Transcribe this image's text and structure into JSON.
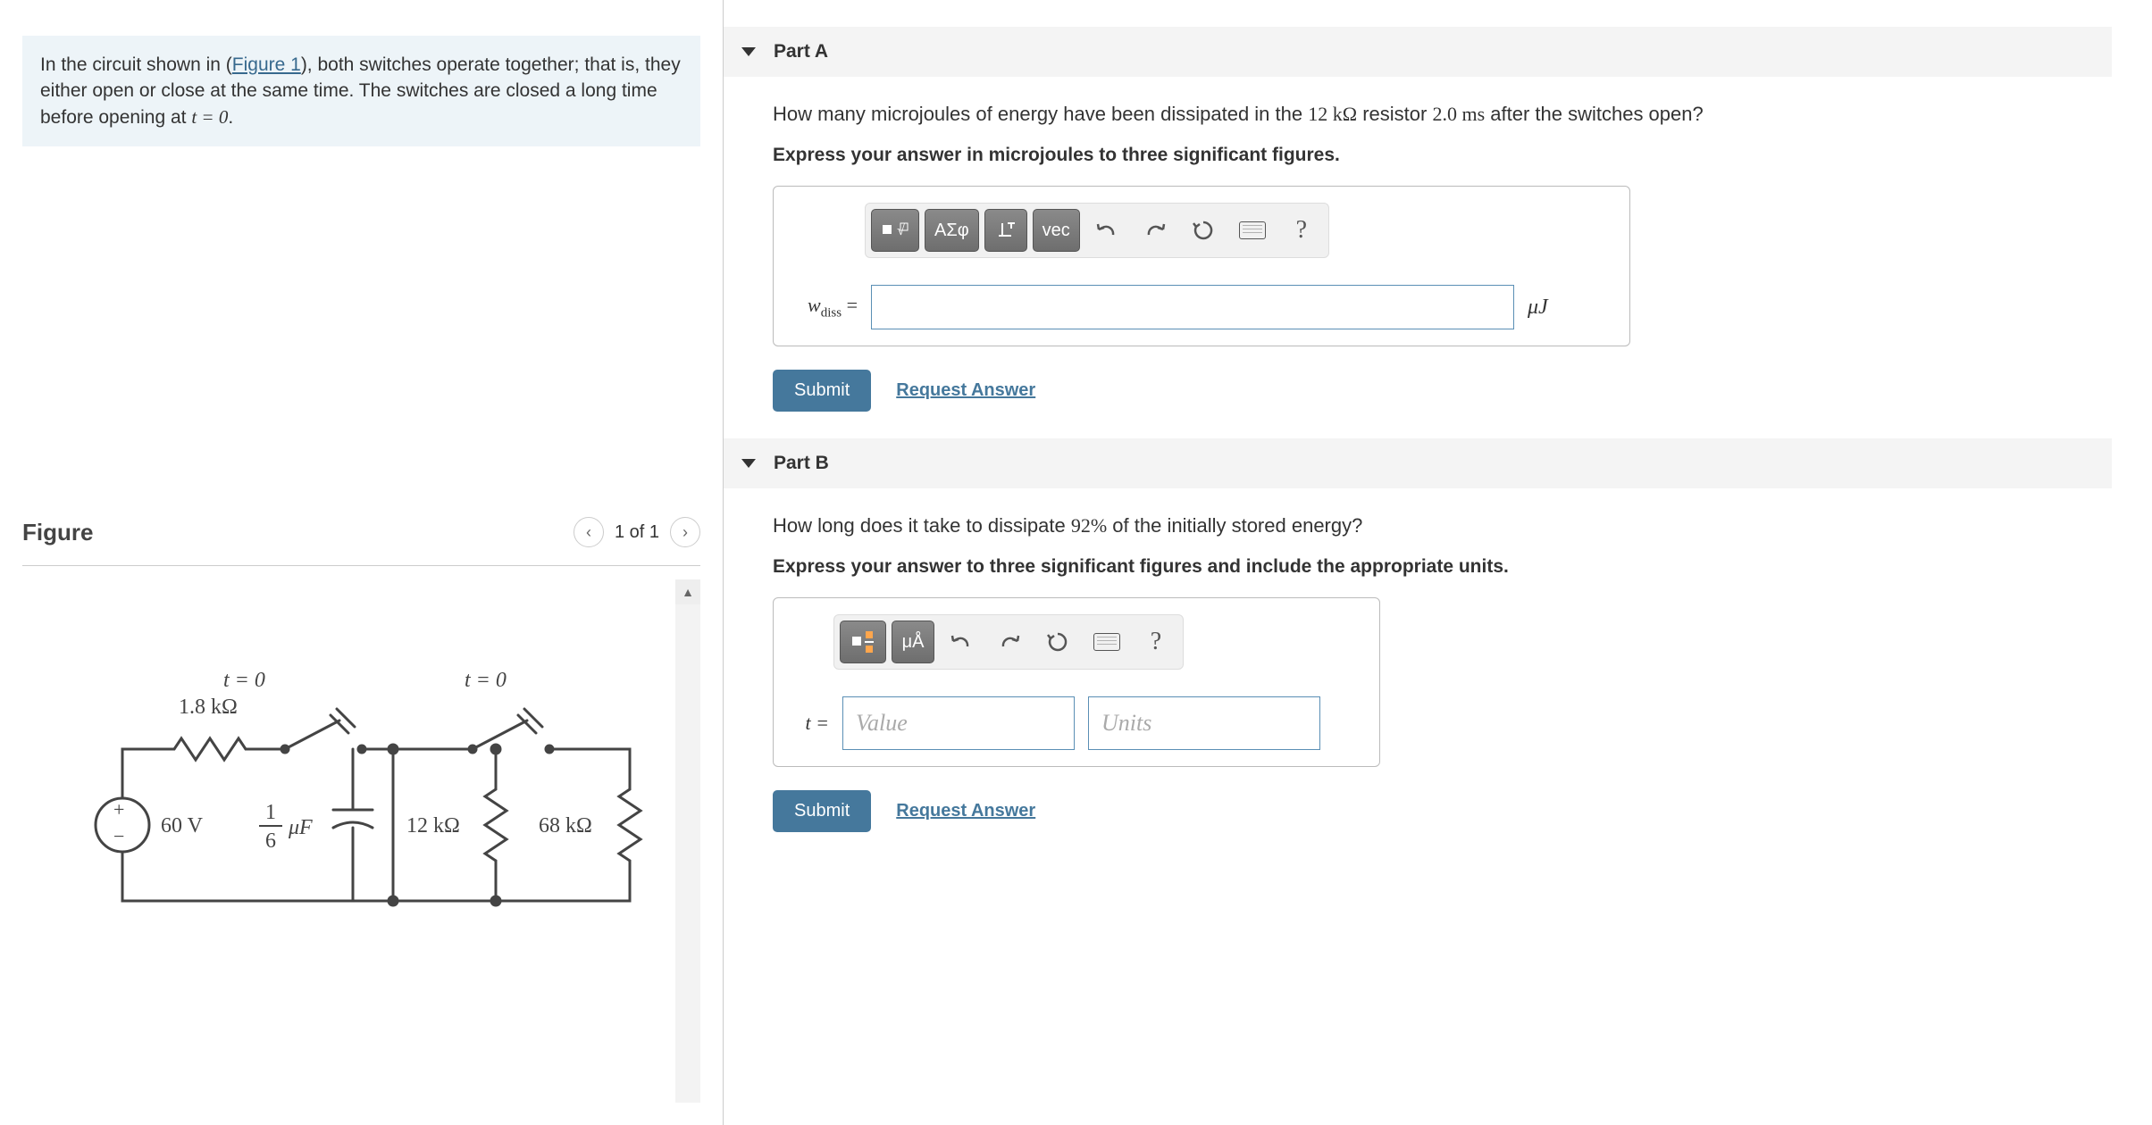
{
  "intro": {
    "prefix": "In the circuit shown in (",
    "figure_link": "Figure 1",
    "suffix": "), both switches operate together; that is, they either open or close at the same time. The switches are closed a long time before opening at ",
    "eqn": "t = 0",
    "end": "."
  },
  "figure": {
    "title": "Figure",
    "count": "1 of 1",
    "circuit": {
      "t0_left": "t = 0",
      "r1": "1.8 kΩ",
      "t0_right": "t = 0",
      "vsrc": "60 V",
      "cap_frac_top": "1",
      "cap_frac_bot": "6",
      "cap_unit": "μF",
      "r2": "12 kΩ",
      "r3": "68 kΩ"
    }
  },
  "partA": {
    "title": "Part A",
    "question_pre": "How many microjoules of energy have been dissipated in the ",
    "q_val1": "12 kΩ",
    "q_mid": " resistor ",
    "q_val2": "2.0 ms",
    "q_post": " after the switches open?",
    "instruction": "Express your answer in microjoules to three significant figures.",
    "toolbar": {
      "greek": "ΑΣφ",
      "vec": "vec"
    },
    "var_main": "w",
    "var_sub": "diss",
    "eq": " =",
    "unit": "μJ",
    "submit": "Submit",
    "request": "Request Answer"
  },
  "partB": {
    "title": "Part B",
    "question_pre": "How long does it take to dissipate ",
    "q_val": "92%",
    "q_post": " of the initially stored energy?",
    "instruction": "Express your answer to three significant figures and include the appropriate units.",
    "toolbar": {
      "units": "μÅ"
    },
    "var": "t =",
    "value_ph": "Value",
    "units_ph": "Units",
    "submit": "Submit",
    "request": "Request Answer"
  }
}
